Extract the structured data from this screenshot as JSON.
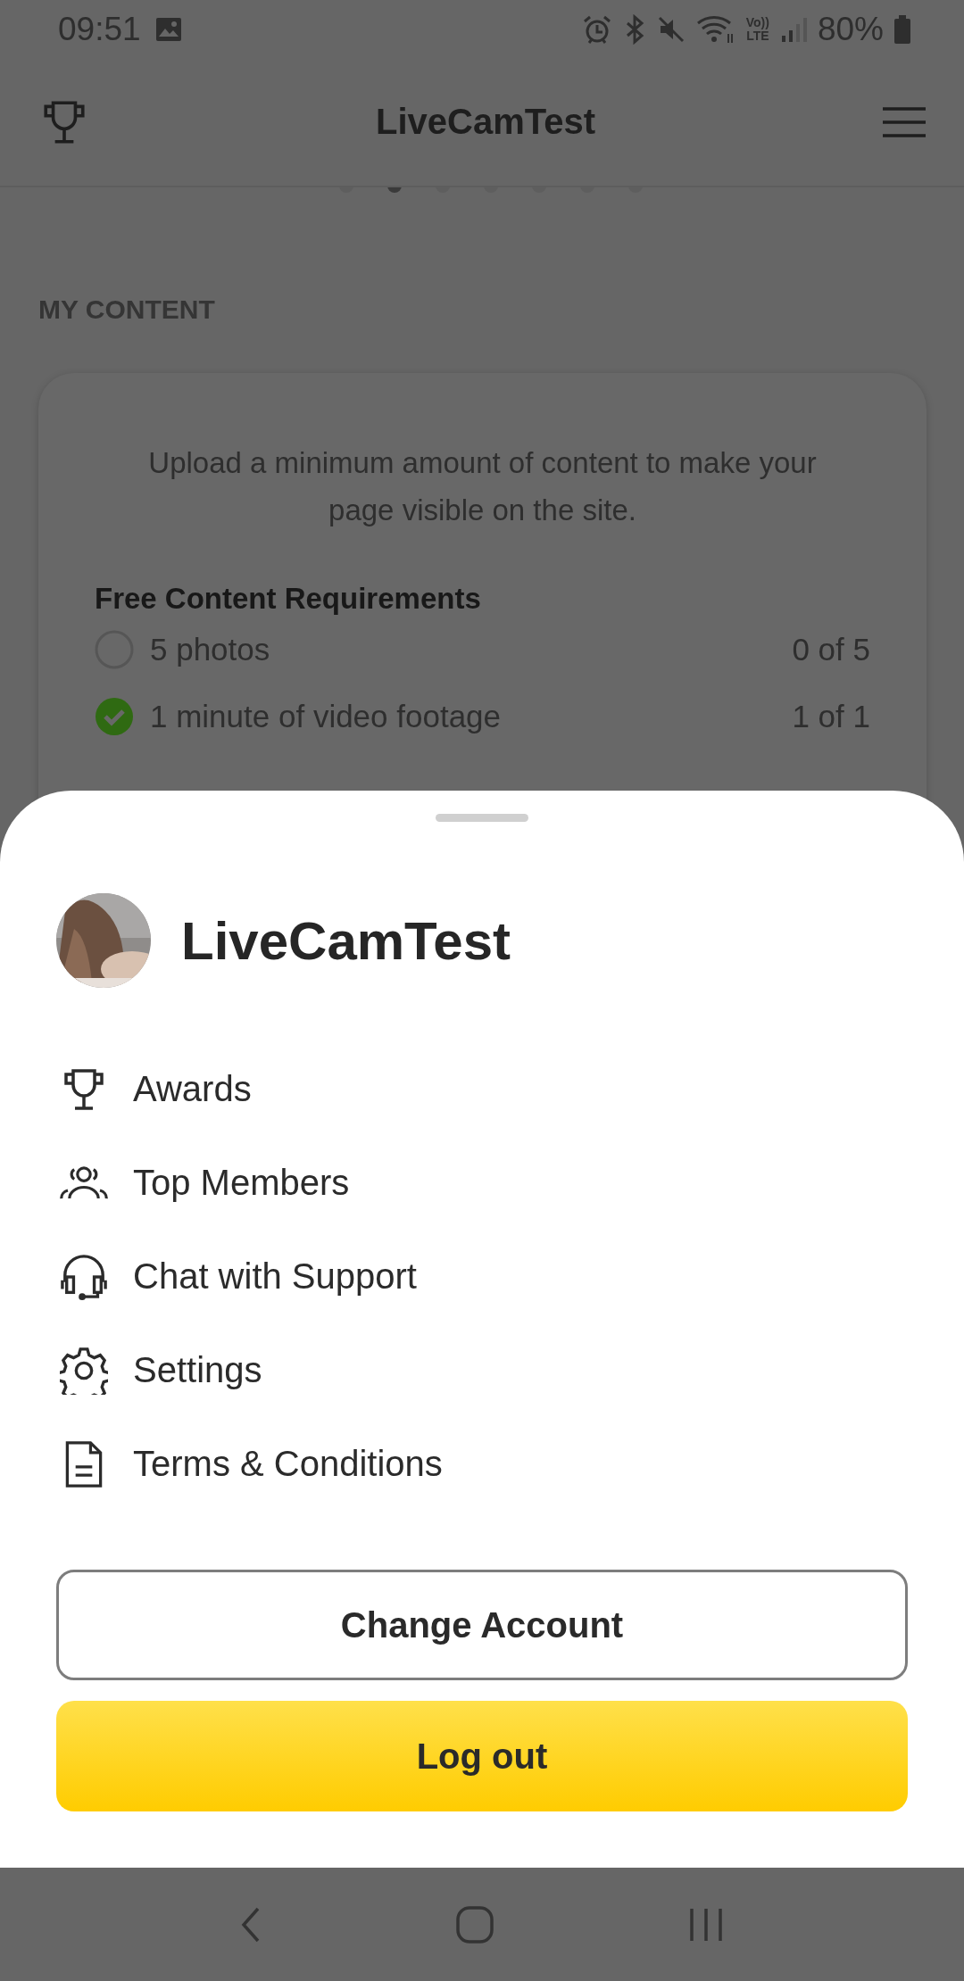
{
  "status_bar": {
    "time": "09:51",
    "volte_top": "Vo))",
    "volte_bottom": "LTE",
    "battery": "80%"
  },
  "header": {
    "title": "LiveCamTest"
  },
  "page_dots": [
    {
      "selected": false
    },
    {
      "selected": true
    },
    {
      "selected": false
    },
    {
      "selected": false
    },
    {
      "selected": false
    },
    {
      "selected": false
    },
    {
      "selected": false
    }
  ],
  "section_title": "MY CONTENT",
  "content_card": {
    "description": "Upload a minimum amount of content to make your page visible on the site.",
    "requirements_title": "Free Content Requirements",
    "requirements": [
      {
        "label": "5 photos",
        "progress": "0 of 5",
        "checked": false
      },
      {
        "label": "1 minute of video footage",
        "progress": "1 of 1",
        "checked": true
      }
    ]
  },
  "account_sheet": {
    "name": "LiveCamTest",
    "menu": [
      {
        "label": "Awards",
        "kind": "trophy"
      },
      {
        "label": "Top Members",
        "kind": "people"
      },
      {
        "label": "Chat with Support",
        "kind": "headset"
      },
      {
        "label": "Settings",
        "kind": "gear"
      },
      {
        "label": "Terms & Conditions",
        "kind": "document"
      }
    ],
    "buttons": [
      {
        "label": "Change Account",
        "kind": "outline"
      },
      {
        "label": "Log out",
        "kind": "primary"
      }
    ]
  }
}
